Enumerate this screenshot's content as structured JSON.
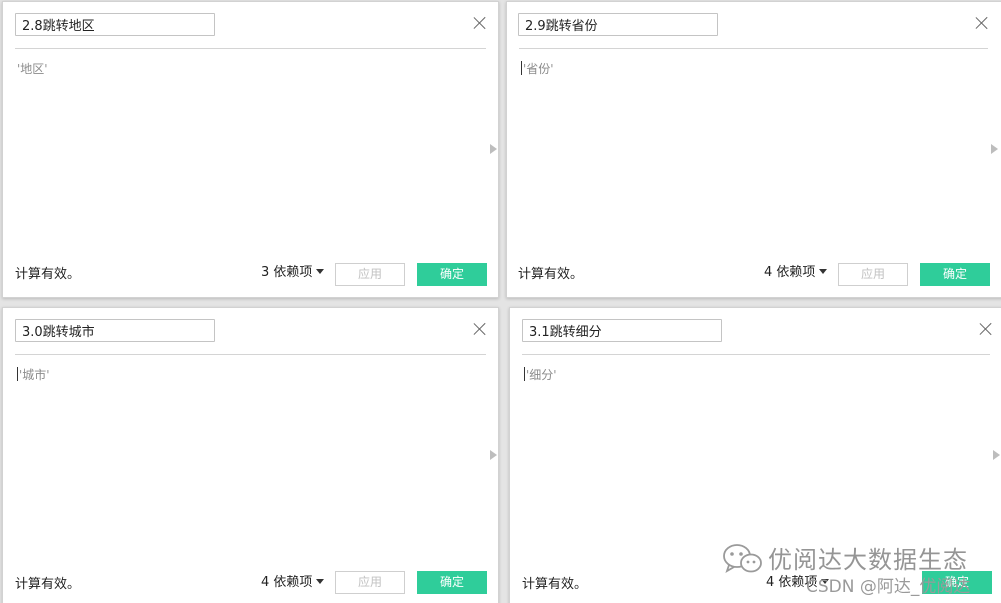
{
  "panels": [
    {
      "name": "2.8跳转地区",
      "formula": "'地区'",
      "has_caret": false,
      "status": "计算有效。",
      "dependencies": "3 依赖项",
      "apply_label": "应用",
      "ok_label": "确定"
    },
    {
      "name": "2.9跳转省份",
      "formula": "'省份'",
      "has_caret": true,
      "status": "计算有效。",
      "dependencies": "4 依赖项",
      "apply_label": "应用",
      "ok_label": "确定"
    },
    {
      "name": "3.0跳转城市",
      "formula": "'城市'",
      "has_caret": true,
      "status": "计算有效。",
      "dependencies": "4 依赖项",
      "apply_label": "应用",
      "ok_label": "确定"
    },
    {
      "name": "3.1跳转细分",
      "formula": "'细分'",
      "has_caret": true,
      "status": "计算有效。",
      "dependencies": "4 依赖项",
      "apply_label": "应用",
      "ok_label": "确定"
    }
  ],
  "watermark": {
    "title": "优阅达大数据生态",
    "subtitle": "CSDN @阿达_优阅达"
  },
  "colors": {
    "ok_button": "#2fcd9a",
    "background": "#e4e4e4"
  }
}
